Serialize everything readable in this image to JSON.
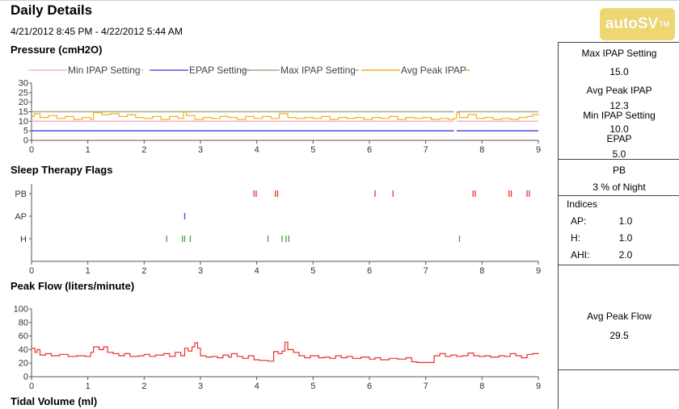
{
  "header": {
    "title": "Daily Details",
    "date_range": "4/21/2012 8:45 PM - 4/22/2012 5:44 AM",
    "logo_text": "autoSV",
    "logo_mark": "TM"
  },
  "sections": {
    "pressure": "Pressure (cmH2O)",
    "flags": "Sleep Therapy Flags",
    "flow": "Peak Flow (liters/minute)",
    "tidal": "Tidal Volume (ml)"
  },
  "colors": {
    "min_ipap": "#f4b8c4",
    "epap": "#5b5be6",
    "max_ipap": "#a7ab86",
    "avg_peak_ipap": "#f2b21c",
    "flag_pb": "#e8312d",
    "flag_ap": "#4848e0",
    "flag_h": "#3fa83f",
    "peak_flow": "#e8312d"
  },
  "panel": {
    "max_ipap_label": "Max IPAP Setting",
    "max_ipap_value": "15.0",
    "avg_peak_ipap_label": "Avg Peak IPAP",
    "avg_peak_ipap_value": "12.3",
    "min_ipap_label": "Min IPAP Setting",
    "min_ipap_value": "10.0",
    "epap_label": "EPAP",
    "epap_value": "5.0",
    "pb_label": "PB",
    "pb_value": "3 % of Night",
    "indices_label": "Indices",
    "ap_label": "AP:",
    "ap_value": "1.0",
    "h_label": "H:",
    "h_value": "1.0",
    "ahi_label": "AHI:",
    "ahi_value": "2.0",
    "avg_peak_flow_label": "Avg Peak Flow",
    "avg_peak_flow_value": "29.5"
  },
  "chart_data": [
    {
      "id": "pressure",
      "type": "line",
      "title": "Pressure (cmH2O)",
      "xlim": [
        0,
        9
      ],
      "ylim": [
        0,
        30
      ],
      "x_ticks": [
        "0",
        "1",
        "2",
        "3",
        "4",
        "5",
        "6",
        "7",
        "8",
        "9"
      ],
      "y_ticks": [
        "0",
        "5",
        "10",
        "15",
        "20",
        "25",
        "30"
      ],
      "legend_position": "top",
      "series": [
        {
          "name": "Min IPAP Setting",
          "color_key": "min_ipap",
          "segments": [
            [
              [
                0,
                10
              ],
              [
                7.5,
                10
              ]
            ],
            [
              [
                7.55,
                10
              ],
              [
                9,
                10
              ]
            ]
          ]
        },
        {
          "name": "EPAP Setting",
          "color_key": "epap",
          "segments": [
            [
              [
                0,
                5
              ],
              [
                7.5,
                5
              ]
            ],
            [
              [
                7.55,
                5
              ],
              [
                9,
                5
              ]
            ]
          ]
        },
        {
          "name": "Max IPAP Setting",
          "color_key": "max_ipap",
          "segments": [
            [
              [
                0,
                15
              ],
              [
                7.5,
                15
              ]
            ],
            [
              [
                7.55,
                15
              ],
              [
                9,
                15
              ]
            ]
          ]
        },
        {
          "name": "Avg Peak IPAP",
          "color_key": "avg_peak_ipap",
          "points": [
            [
              0,
              12.5
            ],
            [
              0.05,
              14
            ],
            [
              0.15,
              12
            ],
            [
              0.3,
              13
            ],
            [
              0.45,
              11.5
            ],
            [
              0.6,
              12.5
            ],
            [
              0.75,
              11
            ],
            [
              0.9,
              12
            ],
            [
              1.05,
              11
            ],
            [
              1.1,
              14.5
            ],
            [
              1.25,
              13.5
            ],
            [
              1.4,
              14
            ],
            [
              1.55,
              12.5
            ],
            [
              1.7,
              13.5
            ],
            [
              1.85,
              12
            ],
            [
              2.0,
              11.5
            ],
            [
              2.15,
              12.5
            ],
            [
              2.3,
              11
            ],
            [
              2.45,
              12.5
            ],
            [
              2.6,
              11.5
            ],
            [
              2.7,
              15
            ],
            [
              2.75,
              13
            ],
            [
              2.9,
              11
            ],
            [
              3.05,
              12
            ],
            [
              3.2,
              11.5
            ],
            [
              3.35,
              12.5
            ],
            [
              3.5,
              12
            ],
            [
              3.65,
              11
            ],
            [
              3.8,
              12.5
            ],
            [
              3.95,
              11.5
            ],
            [
              4.1,
              12.5
            ],
            [
              4.25,
              11.5
            ],
            [
              4.4,
              14
            ],
            [
              4.55,
              12
            ],
            [
              4.7,
              11.5
            ],
            [
              4.85,
              12
            ],
            [
              5.0,
              11.5
            ],
            [
              5.15,
              12.5
            ],
            [
              5.3,
              11
            ],
            [
              5.45,
              12
            ],
            [
              5.6,
              11.5
            ],
            [
              5.75,
              12
            ],
            [
              5.9,
              11
            ],
            [
              6.05,
              12
            ],
            [
              6.2,
              11.5
            ],
            [
              6.35,
              12.5
            ],
            [
              6.5,
              11
            ],
            [
              6.65,
              12
            ],
            [
              6.8,
              11.5
            ],
            [
              6.95,
              12
            ],
            [
              7.1,
              11
            ],
            [
              7.25,
              11.5
            ],
            [
              7.4,
              11
            ],
            [
              7.5,
              11.5
            ],
            [
              7.55,
              14.5
            ],
            [
              7.6,
              12
            ],
            [
              7.75,
              13.5
            ],
            [
              7.9,
              11.5
            ],
            [
              8.05,
              12
            ],
            [
              8.2,
              11
            ],
            [
              8.35,
              11.5
            ],
            [
              8.5,
              11
            ],
            [
              8.65,
              12
            ],
            [
              8.8,
              12.5
            ],
            [
              8.9,
              13.5
            ],
            [
              9,
              14
            ]
          ]
        }
      ]
    },
    {
      "id": "flags",
      "type": "scatter",
      "title": "Sleep Therapy Flags",
      "xlim": [
        0,
        9
      ],
      "x_ticks": [
        "0",
        "1",
        "2",
        "3",
        "4",
        "5",
        "6",
        "7",
        "8",
        "9"
      ],
      "categories": [
        "PB",
        "AP",
        "H"
      ],
      "series": [
        {
          "name": "PB",
          "color_key": "flag_pb",
          "x": [
            3.95,
            3.99,
            4.33,
            4.37,
            6.1,
            6.42,
            7.84,
            7.88,
            8.48,
            8.52,
            8.8,
            8.84
          ]
        },
        {
          "name": "AP",
          "color_key": "flag_ap",
          "x": [
            2.72
          ]
        },
        {
          "name": "H",
          "color_key": "flag_h",
          "x": [
            2.4,
            2.68,
            2.72,
            2.82,
            4.2,
            4.45,
            4.52,
            4.57,
            7.6
          ]
        }
      ]
    },
    {
      "id": "peak_flow",
      "type": "line",
      "title": "Peak Flow (liters/minute)",
      "xlim": [
        0,
        9
      ],
      "ylim": [
        0,
        100
      ],
      "x_ticks": [
        "0",
        "1",
        "2",
        "3",
        "4",
        "5",
        "6",
        "7",
        "8",
        "9"
      ],
      "y_ticks": [
        "0",
        "20",
        "40",
        "60",
        "80",
        "100"
      ],
      "series": [
        {
          "name": "Peak Flow",
          "color_key": "peak_flow",
          "points": [
            [
              0,
              42
            ],
            [
              0.06,
              36
            ],
            [
              0.1,
              40
            ],
            [
              0.15,
              32
            ],
            [
              0.25,
              34
            ],
            [
              0.35,
              31
            ],
            [
              0.5,
              33
            ],
            [
              0.65,
              30
            ],
            [
              0.8,
              31
            ],
            [
              0.95,
              30
            ],
            [
              1.05,
              36
            ],
            [
              1.1,
              44
            ],
            [
              1.2,
              40
            ],
            [
              1.28,
              44
            ],
            [
              1.35,
              36
            ],
            [
              1.45,
              34
            ],
            [
              1.55,
              31
            ],
            [
              1.65,
              34
            ],
            [
              1.75,
              30
            ],
            [
              1.9,
              31
            ],
            [
              2.0,
              33
            ],
            [
              2.1,
              30
            ],
            [
              2.2,
              32
            ],
            [
              2.35,
              34
            ],
            [
              2.45,
              30
            ],
            [
              2.55,
              36
            ],
            [
              2.65,
              31
            ],
            [
              2.72,
              42
            ],
            [
              2.78,
              38
            ],
            [
              2.85,
              44
            ],
            [
              2.9,
              50
            ],
            [
              2.95,
              42
            ],
            [
              3.0,
              31
            ],
            [
              3.1,
              29
            ],
            [
              3.2,
              30
            ],
            [
              3.3,
              28
            ],
            [
              3.4,
              32
            ],
            [
              3.5,
              29
            ],
            [
              3.55,
              34
            ],
            [
              3.65,
              30
            ],
            [
              3.75,
              27
            ],
            [
              3.85,
              31
            ],
            [
              3.95,
              25
            ],
            [
              4.05,
              24
            ],
            [
              4.2,
              23
            ],
            [
              4.3,
              37
            ],
            [
              4.38,
              34
            ],
            [
              4.45,
              38
            ],
            [
              4.5,
              51
            ],
            [
              4.55,
              40
            ],
            [
              4.65,
              36
            ],
            [
              4.75,
              31
            ],
            [
              4.85,
              28
            ],
            [
              4.95,
              31
            ],
            [
              5.1,
              28
            ],
            [
              5.2,
              29
            ],
            [
              5.3,
              27
            ],
            [
              5.4,
              31
            ],
            [
              5.5,
              28
            ],
            [
              5.6,
              30
            ],
            [
              5.7,
              27
            ],
            [
              5.85,
              29
            ],
            [
              6.0,
              26
            ],
            [
              6.1,
              28
            ],
            [
              6.2,
              25
            ],
            [
              6.35,
              27
            ],
            [
              6.5,
              26
            ],
            [
              6.65,
              28
            ],
            [
              6.75,
              22
            ],
            [
              6.85,
              21
            ],
            [
              6.95,
              21
            ],
            [
              7.05,
              21
            ],
            [
              7.15,
              31
            ],
            [
              7.25,
              34
            ],
            [
              7.35,
              30
            ],
            [
              7.45,
              32
            ],
            [
              7.55,
              30
            ],
            [
              7.65,
              31
            ],
            [
              7.75,
              35
            ],
            [
              7.85,
              31
            ],
            [
              7.95,
              30
            ],
            [
              8.05,
              31
            ],
            [
              8.15,
              29
            ],
            [
              8.3,
              31
            ],
            [
              8.4,
              30
            ],
            [
              8.5,
              34
            ],
            [
              8.6,
              31
            ],
            [
              8.7,
              28
            ],
            [
              8.8,
              33
            ],
            [
              8.9,
              34
            ],
            [
              9,
              35
            ]
          ]
        }
      ]
    }
  ]
}
